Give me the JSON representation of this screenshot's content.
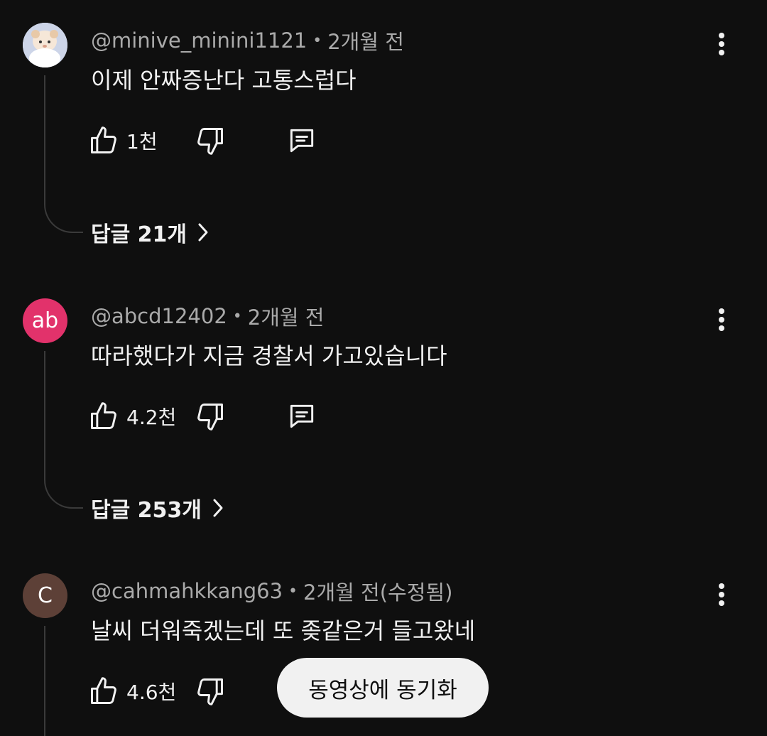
{
  "comments": [
    {
      "handle": "@minive_minini1121",
      "separator": "•",
      "time": "2개월 전",
      "text": "이제 안짜증난다 고통스럽다",
      "like_count": "1천",
      "replies_label": "답글 21개",
      "avatar_type": "image"
    },
    {
      "handle": "@abcd12402",
      "separator": "•",
      "time": "2개월 전",
      "text": "따라했다가 지금 경찰서 가고있습니다",
      "like_count": "4.2천",
      "replies_label": "답글 253개",
      "avatar_letter": "ab",
      "avatar_color": "#e2326b"
    },
    {
      "handle": "@cahmahkkang63",
      "separator": "•",
      "time": "2개월 전(수정됨)",
      "text": "날씨 더워죽겠는데 또 좆같은거 들고왔네",
      "like_count": "4.6천",
      "avatar_letter": "C",
      "avatar_color": "#5d4037"
    }
  ],
  "icons": {
    "like": "thumb-up-icon",
    "dislike": "thumb-down-icon",
    "reply": "comment-icon",
    "more": "more-vert-icon",
    "chevron": "chevron-right-icon"
  },
  "sync_button": {
    "label": "동영상에 동기화"
  },
  "colors": {
    "background": "#0f0f0f",
    "text_primary": "#f1f1f1",
    "text_secondary": "#aaaaaa",
    "thread_line": "#3a3a3a"
  }
}
